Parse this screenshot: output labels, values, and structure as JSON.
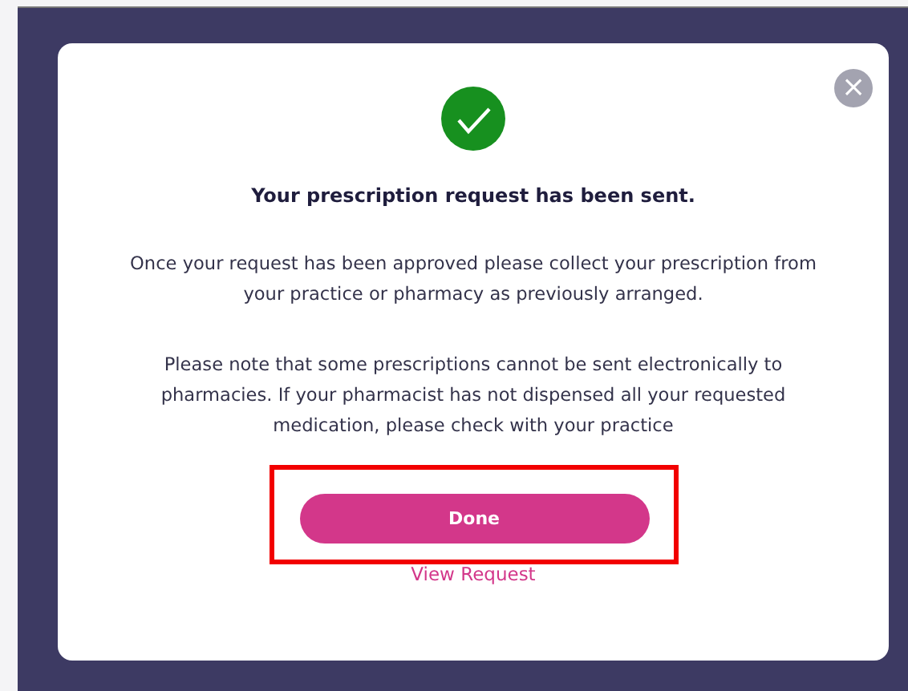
{
  "dialog": {
    "close_button": "×",
    "title": "Your prescription request has been sent.",
    "paragraphs": [
      "Once your request has been approved please collect your prescription from your practice or pharmacy as previously arranged.",
      "Please note that some prescriptions cannot be sent electronically to pharmacies. If your pharmacist has not dispensed all your requested medication, please check with your practice"
    ],
    "primary_button": {
      "label": "Done",
      "highlighted": true
    },
    "link": "View Request"
  }
}
